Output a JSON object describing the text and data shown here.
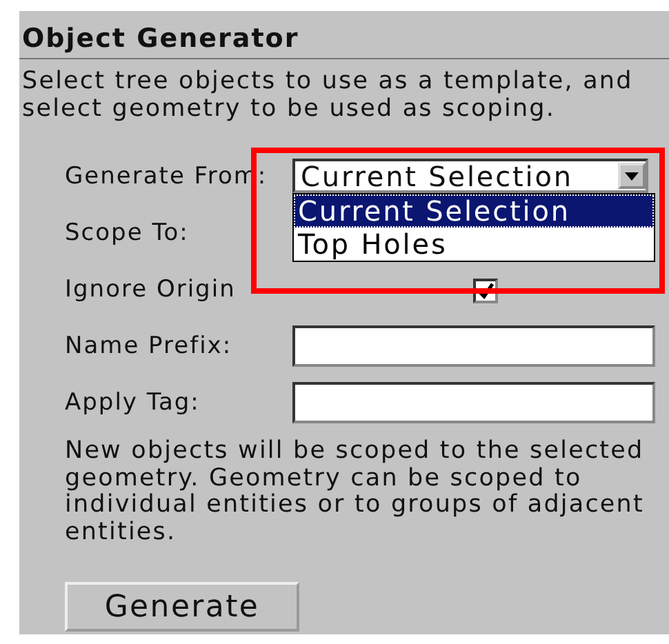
{
  "panel": {
    "title": "Object Generator",
    "description": "Select tree objects to use as a template, and\nselect geometry to be used as scoping.",
    "fields": [
      {
        "kind": "dropdown",
        "label": "Generate From:",
        "value": "Current Selection",
        "expanded": true,
        "options": [
          {
            "label": "Current Selection",
            "selected": true
          },
          {
            "label": "Top Holes",
            "selected": false
          }
        ]
      },
      {
        "kind": "label",
        "label": "Scope To:"
      },
      {
        "kind": "checkbox",
        "label": "Ignore Origin",
        "checked": true
      },
      {
        "kind": "text",
        "label": "Name Prefix:"
      },
      {
        "kind": "text",
        "label": "Apply Tag:"
      }
    ],
    "note": "New objects will be scoped to the selected\ngeometry. Geometry can be scoped to\nindividual entities or to groups of adjacent\nentities.",
    "button": "Generate"
  }
}
